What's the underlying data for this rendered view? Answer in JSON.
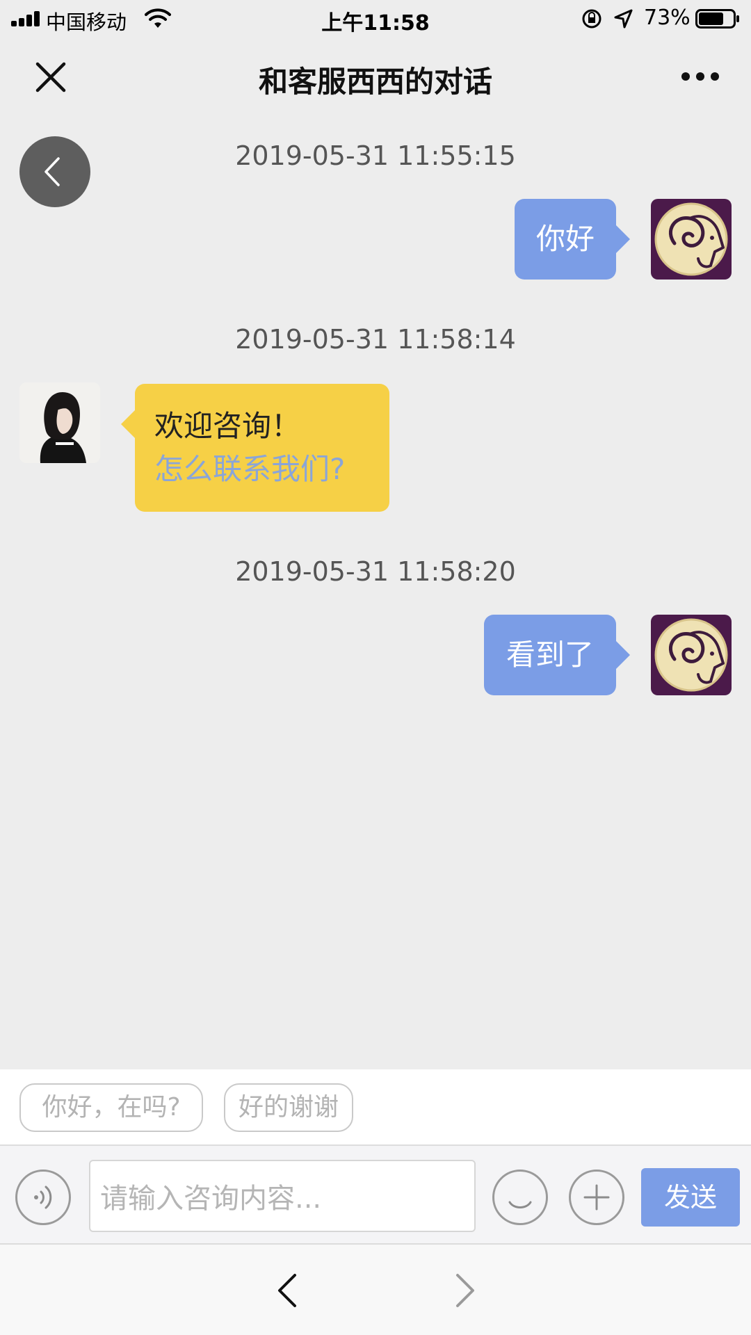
{
  "status_bar": {
    "carrier": "中国移动",
    "time": "上午11:58",
    "battery": "73%",
    "battery_level": 0.73
  },
  "nav": {
    "title": "和客服西西的对话",
    "close_icon": "close-icon",
    "more_icon": "more-icon"
  },
  "messages": [
    {
      "timestamp": "2019-05-31 11:55:15",
      "direction": "outgoing",
      "text": "你好",
      "avatar": "ram-avatar"
    },
    {
      "timestamp": "2019-05-31 11:58:14",
      "direction": "incoming",
      "text": "欢迎咨询！",
      "link": "怎么联系我们?",
      "avatar": "agent-avatar"
    },
    {
      "timestamp": "2019-05-31 11:58:20",
      "direction": "outgoing",
      "text": "看到了",
      "avatar": "ram-avatar"
    }
  ],
  "quick_replies": [
    "你好，在吗?",
    "好的谢谢"
  ],
  "input": {
    "placeholder": "请输入咨询内容...",
    "value": "",
    "send_label": "发送"
  },
  "colors": {
    "background": "#ededed",
    "outgoing_bubble": "#7b9de6",
    "incoming_bubble": "#f6d046",
    "link": "#8aa5d8",
    "send_button": "#7b9de6"
  }
}
